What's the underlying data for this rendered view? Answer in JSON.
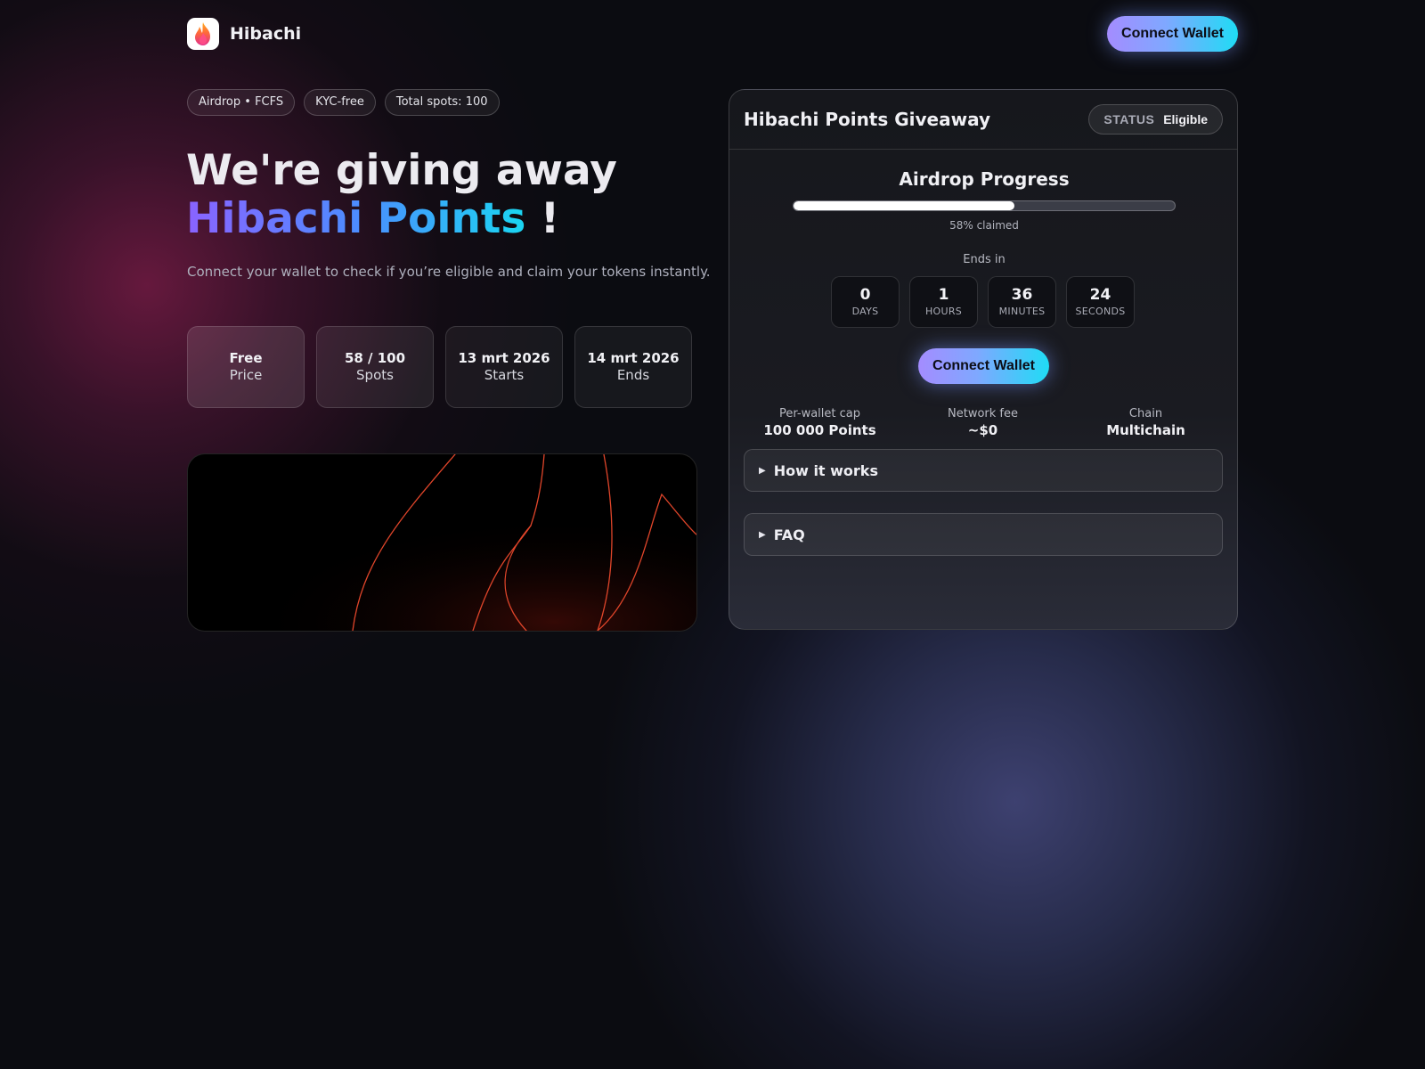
{
  "header": {
    "brand": "Hibachi",
    "connect_label": "Connect Wallet"
  },
  "chips": [
    "Airdrop • FCFS",
    "KYC-free",
    "Total spots: 100"
  ],
  "hero": {
    "headline_line1": "We're giving away",
    "headline_highlight": "Hibachi Points",
    "headline_suffix": " !",
    "subtitle": "Connect your wallet to check if you’re eligible and claim your tokens instantly."
  },
  "stats": [
    {
      "value": "Free",
      "label": "Price"
    },
    {
      "value": "58 / 100",
      "label": "Spots"
    },
    {
      "value": "13 mrt 2026",
      "label": "Starts"
    },
    {
      "value": "14 mrt 2026",
      "label": "Ends"
    }
  ],
  "card": {
    "title": "Hibachi Points Giveaway",
    "status_key": "STATUS",
    "status_value": "Eligible",
    "progress_title": "Airdrop Progress",
    "progress_fraction": 0.58,
    "progress_text": "58% claimed",
    "ends_label": "Ends in",
    "countdown": [
      {
        "value": "0",
        "unit": "DAYS"
      },
      {
        "value": "1",
        "unit": "HOURS"
      },
      {
        "value": "36",
        "unit": "MINUTES"
      },
      {
        "value": "24",
        "unit": "SECONDS"
      }
    ],
    "connect_label": "Connect Wallet",
    "meta": [
      {
        "label": "Per-wallet cap",
        "value": "100 000 Points"
      },
      {
        "label": "Network fee",
        "value": "~$0"
      },
      {
        "label": "Chain",
        "value": "Multichain"
      }
    ],
    "accordions": [
      {
        "label": "How it works"
      },
      {
        "label": "FAQ"
      }
    ]
  },
  "colors": {
    "background": "#0b0c11",
    "accent_start": "#8a63ff",
    "accent_end": "#1ad6f2",
    "flame_stroke": "#e0452a"
  },
  "icons": {
    "logo": "flame-logo-icon",
    "accordion_caret": "caret-right-icon"
  }
}
